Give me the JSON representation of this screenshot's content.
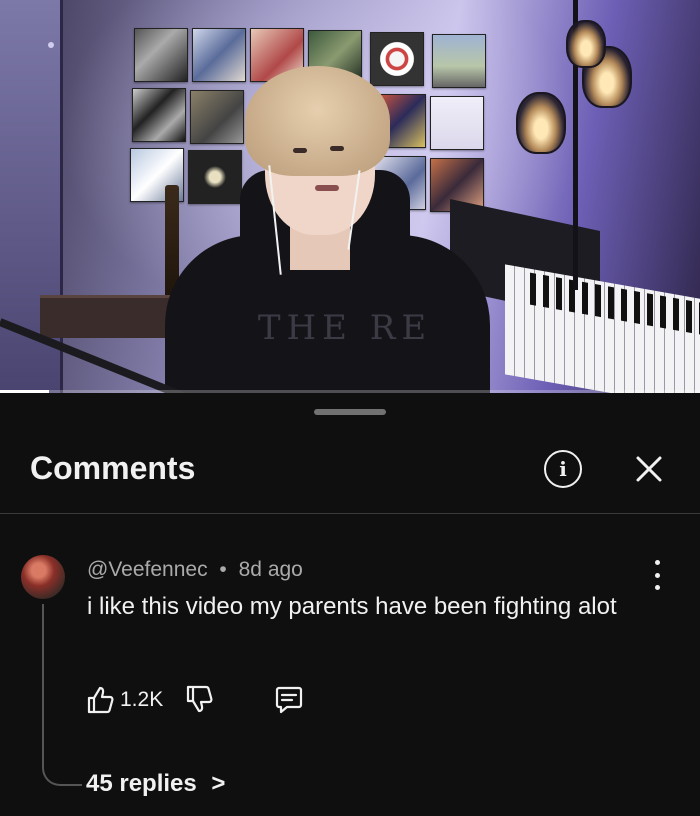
{
  "video": {
    "shirt_text": "THE    RE",
    "progress_fraction": 0.07
  },
  "comments_panel": {
    "title": "Comments"
  },
  "comment": {
    "author": "@Veefennec",
    "separator": "•",
    "time_ago": "8d ago",
    "text": "i like this video my parents have been fighting alot",
    "likes": "1.2K",
    "replies_label": "45 replies",
    "replies_chevron": ">"
  },
  "icons": {
    "info": "info-icon",
    "close": "close-icon",
    "more": "more-vertical-icon",
    "like": "thumbs-up-icon",
    "dislike": "thumbs-down-icon",
    "reply": "reply-comment-icon",
    "chevron": "chevron-right-icon"
  },
  "colors": {
    "background": "#0f0f0f",
    "text": "#f1f1f1",
    "muted": "#aaaaaa",
    "divider": "#3a3a3a"
  }
}
